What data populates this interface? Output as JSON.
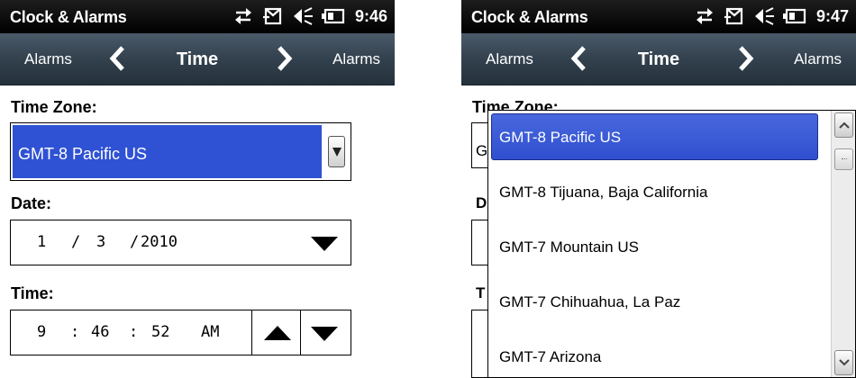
{
  "left": {
    "status": {
      "app_title": "Clock & Alarms",
      "time": "9:46"
    },
    "nav": {
      "prev": "Alarms",
      "title": "Time",
      "next": "Alarms"
    },
    "time_zone": {
      "label": "Time Zone:",
      "value": "GMT-8 Pacific US"
    },
    "date": {
      "label": "Date:",
      "month": "1",
      "day": "3",
      "year": "2010",
      "sep1": "/",
      "sep2": "/"
    },
    "time": {
      "label": "Time:",
      "hour": "9",
      "minute": "46",
      "second": "52",
      "ampm": "AM",
      "sep1": ":",
      "sep2": ":"
    }
  },
  "right": {
    "status": {
      "app_title": "Clock & Alarms",
      "time": "9:47"
    },
    "nav": {
      "prev": "Alarms",
      "title": "Time",
      "next": "Alarms"
    },
    "time_zone_label": "Time Zone:",
    "hidden_initials": {
      "tz": "G",
      "date": "D",
      "time": "T"
    },
    "dropdown": {
      "options": [
        {
          "label": "GMT-8 Pacific US",
          "selected": true
        },
        {
          "label": "GMT-8 Tijuana, Baja California",
          "selected": false
        },
        {
          "label": "GMT-7 Mountain US",
          "selected": false
        },
        {
          "label": "GMT-7 Chihuahua, La Paz",
          "selected": false
        },
        {
          "label": "GMT-7 Arizona",
          "selected": false
        }
      ],
      "scroll_position": 0.0
    }
  },
  "icons": [
    "sync-icon",
    "message-icon",
    "volume-icon",
    "battery-icon",
    "chevron-left-icon",
    "chevron-right-icon",
    "dropdown-arrow-icon",
    "spin-up-icon",
    "spin-down-icon",
    "scroll-up-icon",
    "scroll-down-icon"
  ],
  "colors": {
    "status_bar": "#000000",
    "nav_bar": "#33414e",
    "selection": "#2f52d4",
    "text": "#000000"
  }
}
